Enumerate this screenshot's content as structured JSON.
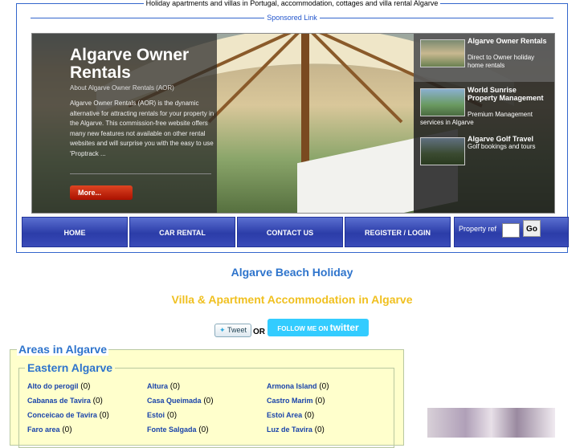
{
  "header": {
    "legend": "Holiday apartments and villas in Portugal, accommodation, cottages and villa rental Algarve",
    "sponsored": "Sponsored Link"
  },
  "slider": {
    "title": "Algarve Owner Rentals",
    "subtitle": "About Algarve Owner Rentals (AOR)",
    "text": "Algarve Owner Rentals (AOR) is the dynamic alternative for attracting rentals for your property in the Algarve. This commission-free website offers many new features not available on other rental websites and will surprise you with the easy to use 'Proptrack ...",
    "more": "More...",
    "thumbs": [
      {
        "title": "Algarve Owner Rentals",
        "desc": "Direct to Owner holiday home rentals"
      },
      {
        "title": "World Sunrise Property Management",
        "desc": "Premium Management services in Algarve"
      },
      {
        "title": "Algarve Golf Travel",
        "desc": "Golf bookings and tours"
      }
    ]
  },
  "nav": {
    "items": [
      "HOME",
      "CAR RENTAL",
      "CONTACT US",
      "REGISTER / LOGIN"
    ],
    "property_label": "Property ref",
    "go": "Go"
  },
  "headings": {
    "main": "Algarve Beach Holiday",
    "sub": "Villa & Apartment Accommodation in Algarve"
  },
  "social": {
    "tweet": "Tweet",
    "or": "OR",
    "follow_prefix": "FOLLOW ME ON",
    "follow_brand": "twitter"
  },
  "areas": {
    "legend": "Areas in Algarve",
    "region": "Eastern Algarve",
    "list": [
      {
        "name": "Alto do perogil",
        "count": "(0)"
      },
      {
        "name": "Altura",
        "count": "(0)"
      },
      {
        "name": "Armona Island",
        "count": "(0)"
      },
      {
        "name": "Cabanas de Tavira",
        "count": "(0)"
      },
      {
        "name": "Casa Queimada",
        "count": "(0)"
      },
      {
        "name": "Castro Marim",
        "count": "(0)"
      },
      {
        "name": "Conceicao de Tavira",
        "count": "(0)"
      },
      {
        "name": "Estoi",
        "count": "(0)"
      },
      {
        "name": "Estoi Area",
        "count": "(0)"
      },
      {
        "name": "Faro area",
        "count": "(0)"
      },
      {
        "name": "Fonte Salgada",
        "count": "(0)"
      },
      {
        "name": "Luz de Tavira",
        "count": "(0)"
      }
    ]
  }
}
